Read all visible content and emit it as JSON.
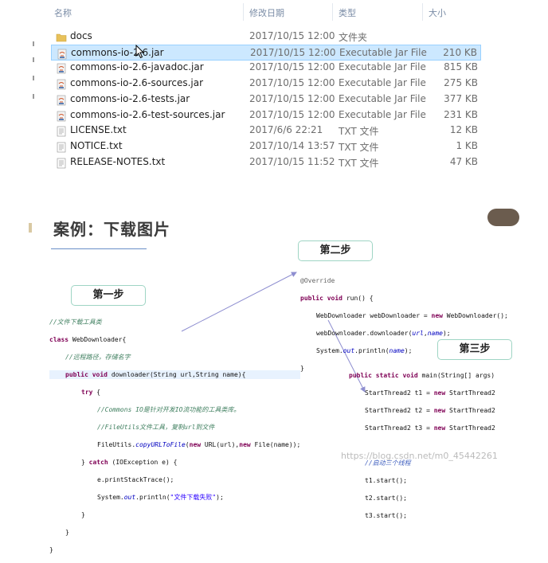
{
  "explorer": {
    "headers": {
      "name": "名称",
      "date": "修改日期",
      "type": "类型",
      "size": "大小"
    },
    "files": [
      {
        "name": "docs",
        "date": "2017/10/15 12:00",
        "type": "文件夹",
        "size": "",
        "icon": "folder-icon"
      },
      {
        "name": "commons-io-2.6.jar",
        "date": "2017/10/15 12:00",
        "type": "Executable Jar File",
        "size": "210 KB",
        "icon": "jar-file-icon",
        "selected": true
      },
      {
        "name": "commons-io-2.6-javadoc.jar",
        "date": "2017/10/15 12:00",
        "type": "Executable Jar File",
        "size": "815 KB",
        "icon": "jar-file-icon"
      },
      {
        "name": "commons-io-2.6-sources.jar",
        "date": "2017/10/15 12:00",
        "type": "Executable Jar File",
        "size": "275 KB",
        "icon": "jar-file-icon"
      },
      {
        "name": "commons-io-2.6-tests.jar",
        "date": "2017/10/15 12:00",
        "type": "Executable Jar File",
        "size": "377 KB",
        "icon": "jar-file-icon"
      },
      {
        "name": "commons-io-2.6-test-sources.jar",
        "date": "2017/10/15 12:00",
        "type": "Executable Jar File",
        "size": "231 KB",
        "icon": "jar-file-icon"
      },
      {
        "name": "LICENSE.txt",
        "date": "2017/6/6 22:21",
        "type": "TXT 文件",
        "size": "12 KB",
        "icon": "text-file-icon"
      },
      {
        "name": "NOTICE.txt",
        "date": "2017/10/14 13:57",
        "type": "TXT 文件",
        "size": "1 KB",
        "icon": "text-file-icon"
      },
      {
        "name": "RELEASE-NOTES.txt",
        "date": "2017/10/15 11:52",
        "type": "TXT 文件",
        "size": "47 KB",
        "icon": "text-file-icon"
      }
    ]
  },
  "slide": {
    "title": "案例：下载图片",
    "step1": "第一步",
    "step2": "第二步",
    "step3": "第三步"
  },
  "code1": {
    "l1": "//文件下载工具类",
    "l2a": "class",
    "l2b": " WebDownloader{",
    "l3": "//远程路径，存储名字",
    "l4a": "public",
    "l4b": " ",
    "l4c": "void",
    "l4d": " downloader(String url,String name){",
    "l5a": "try",
    "l5b": " {",
    "l6": "//Commons IO是针对开发IO流功能的工具类库。",
    "l7": "//FileUtils文件工具，复制url到文件",
    "l8a": "FileUtils.",
    "l8b": "copyURLToFile",
    "l8c": "(",
    "l8d": "new",
    "l8e": " URL(url),",
    "l8f": "new",
    "l8g": " File(name));",
    "l9a": "} ",
    "l9b": "catch",
    "l9c": " (IOException e) {",
    "l10": "e.printStackTrace();",
    "l11a": "System.",
    "l11b": "out",
    "l11c": ".println(",
    "l11d": "\"文件下载失败\"",
    "l11e": ");",
    "l12": "}",
    "l13": "}",
    "l14": "}"
  },
  "code2": {
    "l1": "@Override",
    "l2a": "public",
    "l2b": " ",
    "l2c": "void",
    "l2d": " run() {",
    "l3a": "WebDownloader webDownloader = ",
    "l3b": "new",
    "l3c": " WebDownloader();",
    "l4a": "webDownloader.downloader(",
    "l4b": "url",
    "l4c": ",",
    "l4d": "name",
    "l4e": ");",
    "l5a": "System.",
    "l5b": "out",
    "l5c": ".println(",
    "l5d": "name",
    "l5e": ");",
    "l6": "}"
  },
  "code3": {
    "l1a": "public",
    "l1b": " ",
    "l1c": "static",
    "l1d": " ",
    "l1e": "void",
    "l1f": " main(String[] args)",
    "l2a": "StartThread2 t1 = ",
    "l2b": "new",
    "l2c": " StartThread2",
    "l3a": "StartThread2 t2 = ",
    "l3b": "new",
    "l3c": " StartThread2",
    "l4a": "StartThread2 t3 = ",
    "l4b": "new",
    "l4c": " StartThread2",
    "l5": "//启动三个线程",
    "l6": "t1.start();",
    "l7": "t2.start();",
    "l8": "t3.start();"
  },
  "watermark": "https://blog.csdn.net/m0_45442261",
  "colors": {
    "selection": "#cce8ff",
    "step_border": "#9fd5c4",
    "arrow": "#8e8ed0"
  }
}
